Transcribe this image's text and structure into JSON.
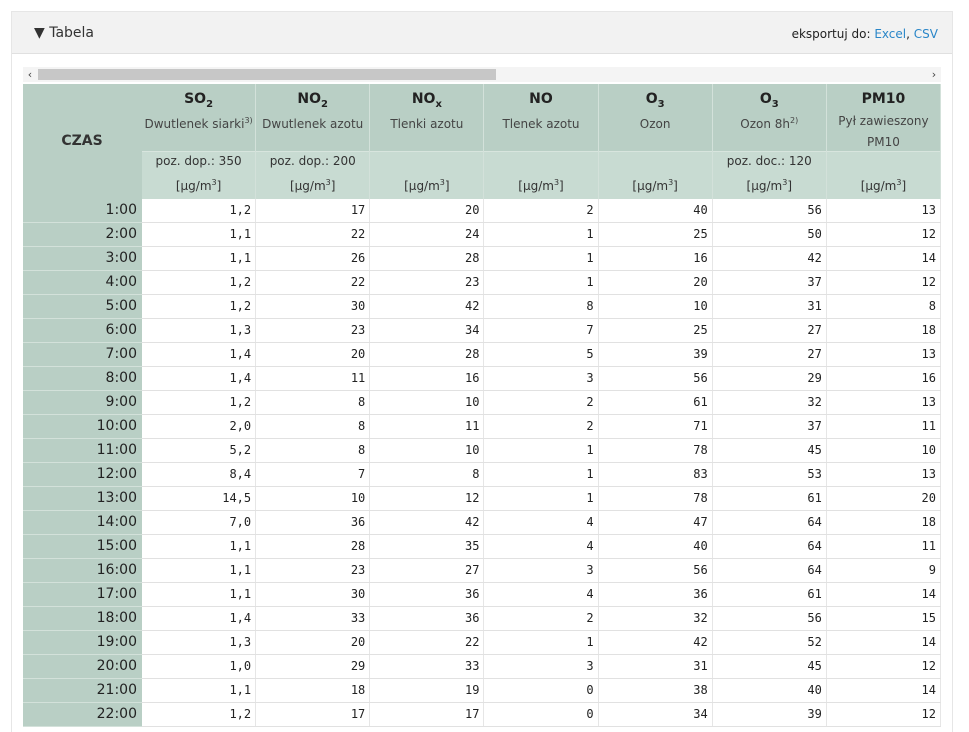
{
  "panel": {
    "title": "▼ Tabela",
    "export_label": "eksportuj do:",
    "export_excel": "Excel",
    "export_sep": ",",
    "export_csv": "CSV"
  },
  "scrollbar": {
    "left_arrow": "‹",
    "right_arrow": "›"
  },
  "table": {
    "time_header": "CZAS",
    "columns": [
      {
        "symbol": "SO",
        "sub": "2",
        "desc": "Dwutlenek siarki",
        "desc_sup": "3)",
        "limit": "poz. dop.: 350",
        "unit": "[µg/m",
        "unit_sup": "3",
        "unit_end": "]"
      },
      {
        "symbol": "NO",
        "sub": "2",
        "desc": "Dwutlenek azotu",
        "desc_sup": "",
        "limit": "poz. dop.: 200",
        "unit": "[µg/m",
        "unit_sup": "3",
        "unit_end": "]"
      },
      {
        "symbol": "NO",
        "sub": "x",
        "desc": "Tlenki azotu",
        "desc_sup": "",
        "limit": "",
        "unit": "[µg/m",
        "unit_sup": "3",
        "unit_end": "]"
      },
      {
        "symbol": "NO",
        "sub": "",
        "desc": "Tlenek azotu",
        "desc_sup": "",
        "limit": "",
        "unit": "[µg/m",
        "unit_sup": "3",
        "unit_end": "]"
      },
      {
        "symbol": "O",
        "sub": "3",
        "desc": "Ozon",
        "desc_sup": "",
        "limit": "",
        "unit": "[µg/m",
        "unit_sup": "3",
        "unit_end": "]"
      },
      {
        "symbol": "O",
        "sub": "3",
        "desc": "Ozon 8h",
        "desc_sup": "2)",
        "limit": "poz. doc.: 120",
        "unit": "[µg/m",
        "unit_sup": "3",
        "unit_end": "]"
      },
      {
        "symbol": "PM10",
        "sub": "",
        "desc": "Pył zawieszony PM10",
        "desc_sup": "",
        "limit": "",
        "unit": "[µg/m",
        "unit_sup": "3",
        "unit_end": "]"
      }
    ],
    "rows": [
      {
        "time": "1:00",
        "values": [
          "1,2",
          "17",
          "20",
          "2",
          "40",
          "56",
          "13"
        ]
      },
      {
        "time": "2:00",
        "values": [
          "1,1",
          "22",
          "24",
          "1",
          "25",
          "50",
          "12"
        ]
      },
      {
        "time": "3:00",
        "values": [
          "1,1",
          "26",
          "28",
          "1",
          "16",
          "42",
          "14"
        ]
      },
      {
        "time": "4:00",
        "values": [
          "1,2",
          "22",
          "23",
          "1",
          "20",
          "37",
          "12"
        ]
      },
      {
        "time": "5:00",
        "values": [
          "1,2",
          "30",
          "42",
          "8",
          "10",
          "31",
          "8"
        ]
      },
      {
        "time": "6:00",
        "values": [
          "1,3",
          "23",
          "34",
          "7",
          "25",
          "27",
          "18"
        ]
      },
      {
        "time": "7:00",
        "values": [
          "1,4",
          "20",
          "28",
          "5",
          "39",
          "27",
          "13"
        ]
      },
      {
        "time": "8:00",
        "values": [
          "1,4",
          "11",
          "16",
          "3",
          "56",
          "29",
          "16"
        ]
      },
      {
        "time": "9:00",
        "values": [
          "1,2",
          "8",
          "10",
          "2",
          "61",
          "32",
          "13"
        ]
      },
      {
        "time": "10:00",
        "values": [
          "2,0",
          "8",
          "11",
          "2",
          "71",
          "37",
          "11"
        ]
      },
      {
        "time": "11:00",
        "values": [
          "5,2",
          "8",
          "10",
          "1",
          "78",
          "45",
          "10"
        ]
      },
      {
        "time": "12:00",
        "values": [
          "8,4",
          "7",
          "8",
          "1",
          "83",
          "53",
          "13"
        ]
      },
      {
        "time": "13:00",
        "values": [
          "14,5",
          "10",
          "12",
          "1",
          "78",
          "61",
          "20"
        ]
      },
      {
        "time": "14:00",
        "values": [
          "7,0",
          "36",
          "42",
          "4",
          "47",
          "64",
          "18"
        ]
      },
      {
        "time": "15:00",
        "values": [
          "1,1",
          "28",
          "35",
          "4",
          "40",
          "64",
          "11"
        ]
      },
      {
        "time": "16:00",
        "values": [
          "1,1",
          "23",
          "27",
          "3",
          "56",
          "64",
          "9"
        ]
      },
      {
        "time": "17:00",
        "values": [
          "1,1",
          "30",
          "36",
          "4",
          "36",
          "61",
          "14"
        ]
      },
      {
        "time": "18:00",
        "values": [
          "1,4",
          "33",
          "36",
          "2",
          "32",
          "56",
          "15"
        ]
      },
      {
        "time": "19:00",
        "values": [
          "1,3",
          "20",
          "22",
          "1",
          "42",
          "52",
          "14"
        ]
      },
      {
        "time": "20:00",
        "values": [
          "1,0",
          "29",
          "33",
          "3",
          "31",
          "45",
          "12"
        ]
      },
      {
        "time": "21:00",
        "values": [
          "1,1",
          "18",
          "19",
          "0",
          "38",
          "40",
          "14"
        ]
      },
      {
        "time": "22:00",
        "values": [
          "1,2",
          "17",
          "17",
          "0",
          "34",
          "39",
          "12"
        ]
      }
    ]
  }
}
